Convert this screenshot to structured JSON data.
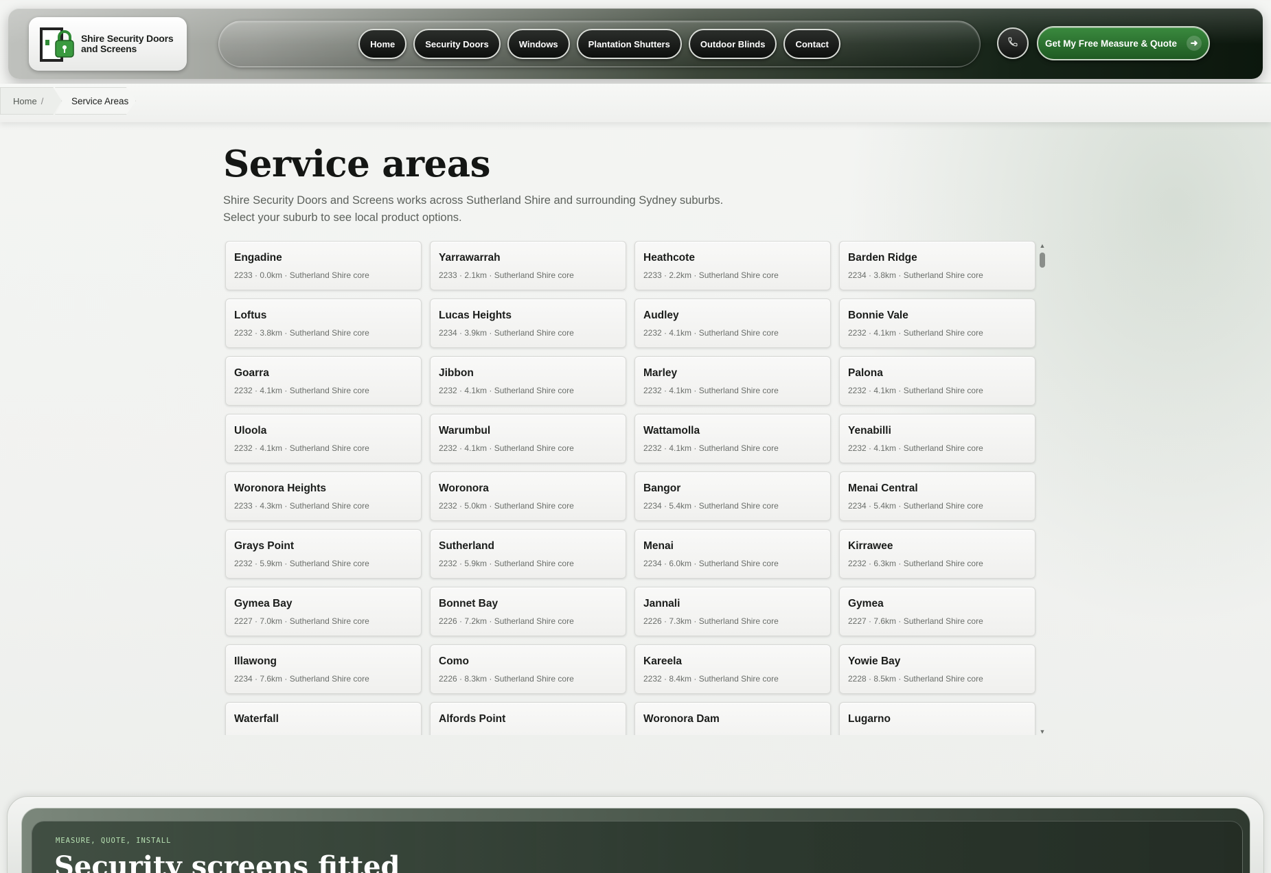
{
  "header": {
    "logo_text_line1": "Shire Security Doors",
    "logo_text_line2": "and Screens",
    "nav": [
      {
        "label": "Home"
      },
      {
        "label": "Security Doors"
      },
      {
        "label": "Windows"
      },
      {
        "label": "Plantation Shutters"
      },
      {
        "label": "Outdoor Blinds"
      },
      {
        "label": "Contact"
      }
    ],
    "cta_label": "Get My Free Measure & Quote",
    "icons": {
      "phone": "phone-icon",
      "cta_arrow": "arrow-right-icon",
      "logo": "padlock-door-icon"
    }
  },
  "breadcrumb": {
    "home": "Home",
    "separator": "/",
    "current": "Service Areas"
  },
  "main": {
    "title": "Service areas",
    "intro_line1": "Shire Security Doors and Screens works across Sutherland Shire and surrounding Sydney suburbs.",
    "intro_line2": "Select your suburb to see local product options.",
    "suburbs": [
      {
        "name": "Engadine",
        "meta": "2233 · 0.0km · Sutherland Shire core"
      },
      {
        "name": "Yarrawarrah",
        "meta": "2233 · 2.1km · Sutherland Shire core"
      },
      {
        "name": "Heathcote",
        "meta": "2233 · 2.2km · Sutherland Shire core"
      },
      {
        "name": "Barden Ridge",
        "meta": "2234 · 3.8km · Sutherland Shire core"
      },
      {
        "name": "Loftus",
        "meta": "2232 · 3.8km · Sutherland Shire core"
      },
      {
        "name": "Lucas Heights",
        "meta": "2234 · 3.9km · Sutherland Shire core"
      },
      {
        "name": "Audley",
        "meta": "2232 · 4.1km · Sutherland Shire core"
      },
      {
        "name": "Bonnie Vale",
        "meta": "2232 · 4.1km · Sutherland Shire core"
      },
      {
        "name": "Goarra",
        "meta": "2232 · 4.1km · Sutherland Shire core"
      },
      {
        "name": "Jibbon",
        "meta": "2232 · 4.1km · Sutherland Shire core"
      },
      {
        "name": "Marley",
        "meta": "2232 · 4.1km · Sutherland Shire core"
      },
      {
        "name": "Palona",
        "meta": "2232 · 4.1km · Sutherland Shire core"
      },
      {
        "name": "Uloola",
        "meta": "2232 · 4.1km · Sutherland Shire core"
      },
      {
        "name": "Warumbul",
        "meta": "2232 · 4.1km · Sutherland Shire core"
      },
      {
        "name": "Wattamolla",
        "meta": "2232 · 4.1km · Sutherland Shire core"
      },
      {
        "name": "Yenabilli",
        "meta": "2232 · 4.1km · Sutherland Shire core"
      },
      {
        "name": "Woronora Heights",
        "meta": "2233 · 4.3km · Sutherland Shire core"
      },
      {
        "name": "Woronora",
        "meta": "2232 · 5.0km · Sutherland Shire core"
      },
      {
        "name": "Bangor",
        "meta": "2234 · 5.4km · Sutherland Shire core"
      },
      {
        "name": "Menai Central",
        "meta": "2234 · 5.4km · Sutherland Shire core"
      },
      {
        "name": "Grays Point",
        "meta": "2232 · 5.9km · Sutherland Shire core"
      },
      {
        "name": "Sutherland",
        "meta": "2232 · 5.9km · Sutherland Shire core"
      },
      {
        "name": "Menai",
        "meta": "2234 · 6.0km · Sutherland Shire core"
      },
      {
        "name": "Kirrawee",
        "meta": "2232 · 6.3km · Sutherland Shire core"
      },
      {
        "name": "Gymea Bay",
        "meta": "2227 · 7.0km · Sutherland Shire core"
      },
      {
        "name": "Bonnet Bay",
        "meta": "2226 · 7.2km · Sutherland Shire core"
      },
      {
        "name": "Jannali",
        "meta": "2226 · 7.3km · Sutherland Shire core"
      },
      {
        "name": "Gymea",
        "meta": "2227 · 7.6km · Sutherland Shire core"
      },
      {
        "name": "Illawong",
        "meta": "2234 · 7.6km · Sutherland Shire core"
      },
      {
        "name": "Como",
        "meta": "2226 · 8.3km · Sutherland Shire core"
      },
      {
        "name": "Kareela",
        "meta": "2232 · 8.4km · Sutherland Shire core"
      },
      {
        "name": "Yowie Bay",
        "meta": "2228 · 8.5km · Sutherland Shire core"
      },
      {
        "name": "Waterfall",
        "meta": ""
      },
      {
        "name": "Alfords Point",
        "meta": ""
      },
      {
        "name": "Woronora Dam",
        "meta": ""
      },
      {
        "name": "Lugarno",
        "meta": ""
      }
    ]
  },
  "banner": {
    "eyebrow": "MEASURE, QUOTE, INSTALL",
    "title": "Security screens fitted"
  },
  "colors": {
    "accent_green": "#2e7a33",
    "header_dark": "#0c170d"
  }
}
